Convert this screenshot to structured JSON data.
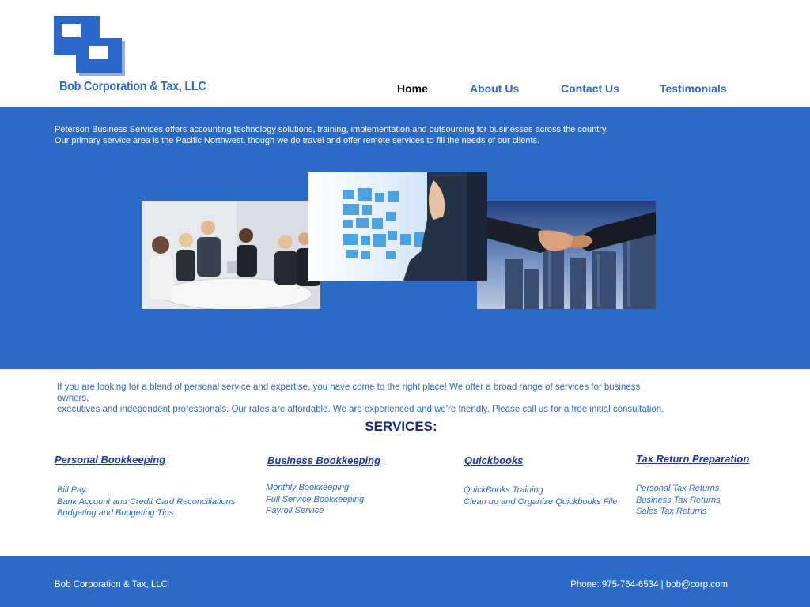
{
  "header": {
    "company_name": "Bob Corporation & Tax, LLC"
  },
  "nav": {
    "home": "Home",
    "about": "About Us",
    "contact": "Contact Us",
    "testimonials": "Testimonials"
  },
  "hero": {
    "line1": "Peterson Business Services offers accounting technology solutions, training, implementation and outsourcing for businesses across the country.",
    "line2": "Our primary service area is the Pacific Northwest, though we do travel and offer remote services to fill the needs of our clients."
  },
  "intro": {
    "line1": "If you are looking for a blend of personal service and expertise, you have come to the right place! We offer a broad range of services for business owners,",
    "line2": "executives and independent professionals. Our rates are affordable. We are experienced and we're friendly. Please call us for a free initial consultation."
  },
  "services": {
    "title": "SERVICES:",
    "columns": [
      {
        "heading": "Personal Bookkeeping",
        "items": [
          "Bill Pay",
          "Bank Account and Credit Card Reconciliations",
          "Budgeting and Budgeting Tips"
        ]
      },
      {
        "heading": "Business Bookkeeping",
        "items": [
          "Monthly Bookkeeping",
          "Full Service Bookkeeping",
          "Payroll Service"
        ]
      },
      {
        "heading": "Quickbooks",
        "items": [
          "QuickBooks Training",
          "Clean up and Organize Quickbooks File"
        ]
      },
      {
        "heading": "Tax Return Preparation",
        "items": [
          "Personal Tax Returns",
          "Business Tax Returns",
          "Sales Tax Returns"
        ]
      }
    ]
  },
  "footer": {
    "company": "Bob Corporation & Tax, LLC",
    "contact": "Phone: 975-764-6534 | bob@corp.com"
  },
  "colors": {
    "brand_blue": "#2b6ac6",
    "heading_navy": "#1a2a88"
  }
}
